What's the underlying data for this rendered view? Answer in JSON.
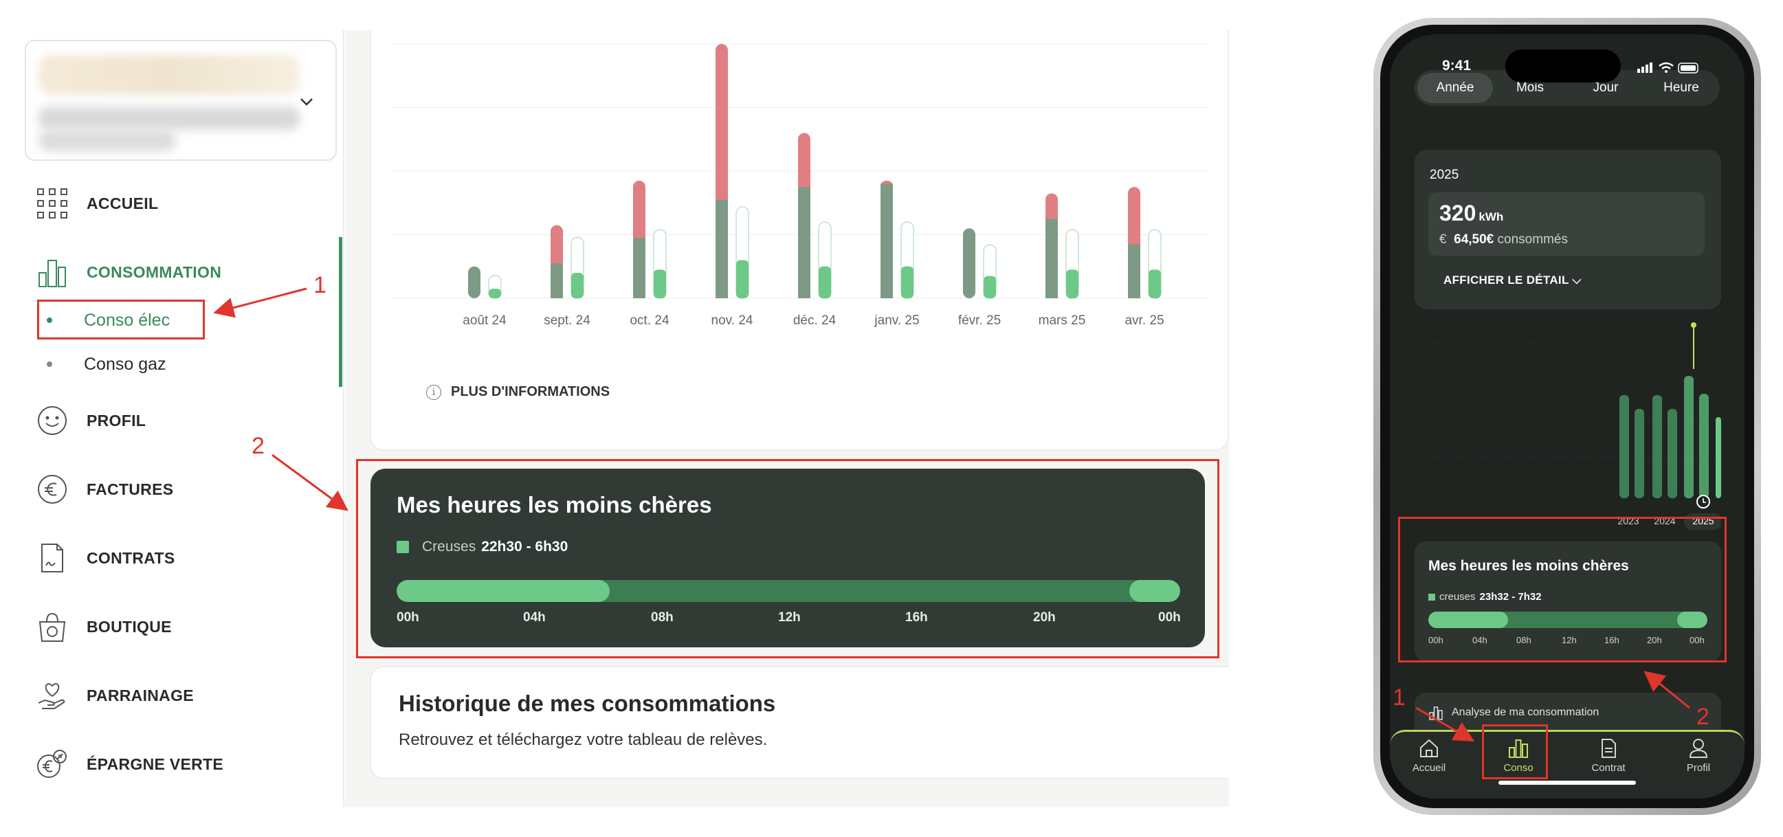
{
  "sidebar": {
    "nav": [
      {
        "label": "ACCUEIL",
        "icon": "grid-icon"
      },
      {
        "label": "CONSOMMATION",
        "icon": "bar-chart-icon"
      },
      {
        "label": "PROFIL",
        "icon": "smiley-icon"
      },
      {
        "label": "FACTURES",
        "icon": "euro-icon"
      },
      {
        "label": "CONTRATS",
        "icon": "document-icon"
      },
      {
        "label": "BOUTIQUE",
        "icon": "shopping-bag-icon"
      },
      {
        "label": "PARRAINAGE",
        "icon": "hand-heart-icon"
      },
      {
        "label": "ÉPARGNE VERTE",
        "icon": "savings-icon"
      }
    ],
    "sub": [
      {
        "label": "Conso élec"
      },
      {
        "label": "Conso gaz"
      }
    ]
  },
  "main": {
    "more_info": "PLUS D'INFORMATIONS",
    "hours_card": {
      "title": "Mes heures les moins chères",
      "legend_label": "Creuses",
      "legend_value": "22h30 - 6h30",
      "ticks": [
        "00h",
        "04h",
        "08h",
        "12h",
        "16h",
        "20h",
        "00h"
      ]
    },
    "history": {
      "title": "Historique de mes consommations",
      "subtitle": "Retrouvez et téléchargez votre tableau de relèves."
    }
  },
  "chart_data": {
    "type": "bar",
    "categories": [
      "août 24",
      "sept. 24",
      "oct. 24",
      "nov. 24",
      "déc. 24",
      "janv. 25",
      "févr. 25",
      "mars 25",
      "avr. 25"
    ],
    "series": [
      {
        "values": [
          10,
          11,
          19,
          31,
          35,
          36,
          22,
          25,
          17
        ]
      },
      {
        "values": [
          0,
          12,
          18,
          49,
          17,
          1,
          0,
          8,
          18
        ]
      },
      {
        "values": [
          3,
          8,
          9,
          12,
          10,
          10,
          7,
          9,
          9
        ]
      }
    ],
    "ylim": [
      0,
      80
    ],
    "colors": {
      "base": "#7e9a86",
      "peak": "#e07f83",
      "comparison": "#6cc987",
      "comparison_outline": "#cfe9d6"
    }
  },
  "phone": {
    "status_time": "9:41",
    "tabs": [
      "Année",
      "Mois",
      "Jour",
      "Heure"
    ],
    "year_card": {
      "year": "2025",
      "kwh_value": "320",
      "kwh_unit": "kWh",
      "cost_symbol": "€",
      "cost_value": "64,50€",
      "cost_label": "consommés",
      "detail_label": "AFFICHER LE DÉTAIL"
    },
    "year_chart": {
      "labels": [
        "2023",
        "2024",
        "2025"
      ]
    },
    "hours_card": {
      "title": "Mes heures les moins chères",
      "legend_label": "creuses",
      "legend_value": "23h32 - 7h32",
      "ticks": [
        "00h",
        "04h",
        "08h",
        "12h",
        "16h",
        "20h",
        "00h"
      ]
    },
    "analyse_label": "Analyse de ma consommation",
    "bottom_nav": [
      {
        "label": "Accueil",
        "icon": "home-icon"
      },
      {
        "label": "Conso",
        "icon": "bar-chart-icon"
      },
      {
        "label": "Contrat",
        "icon": "document-icon"
      },
      {
        "label": "Profil",
        "icon": "person-icon"
      }
    ]
  },
  "annotations": {
    "labels": [
      "1",
      "2",
      "1",
      "2"
    ],
    "color": "#e0352b"
  }
}
